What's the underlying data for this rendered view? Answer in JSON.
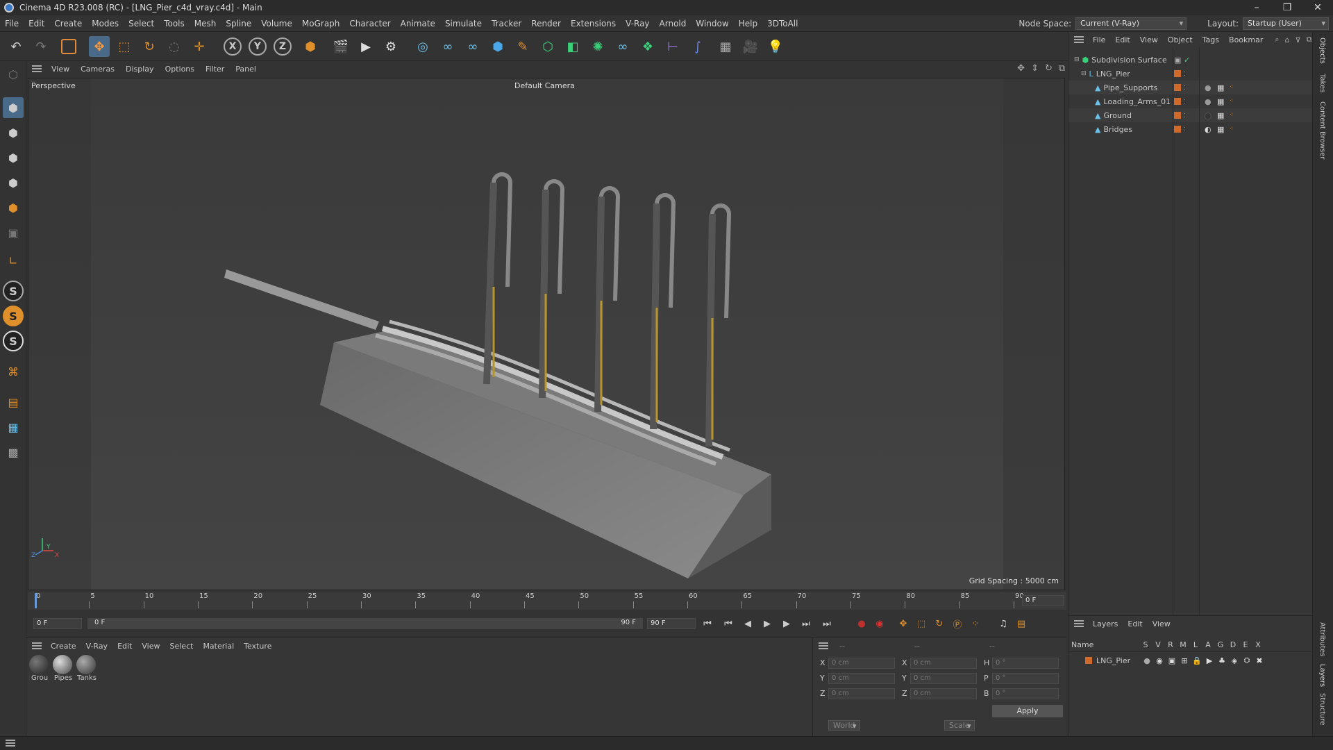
{
  "title": "Cinema 4D R23.008 (RC) - [LNG_Pier_c4d_vray.c4d] - Main",
  "window_controls": [
    "–",
    "❐",
    "✕"
  ],
  "menu": [
    "File",
    "Edit",
    "Create",
    "Modes",
    "Select",
    "Tools",
    "Mesh",
    "Spline",
    "Volume",
    "MoGraph",
    "Character",
    "Animate",
    "Simulate",
    "Tracker",
    "Render",
    "Extensions",
    "V-Ray",
    "Arnold",
    "Window",
    "Help",
    "3DToAll"
  ],
  "node_space": {
    "label": "Node Space:",
    "value": "Current (V-Ray)"
  },
  "layout": {
    "label": "Layout:",
    "value": "Startup (User)"
  },
  "viewport_menu": [
    "View",
    "Cameras",
    "Display",
    "Options",
    "Filter",
    "Panel"
  ],
  "viewport": {
    "name": "Perspective",
    "camera": "Default Camera",
    "grid_spacing": "Grid Spacing : 5000 cm",
    "axis_y": "Y",
    "axis_x": "X",
    "axis_z": "Z"
  },
  "timeline": {
    "ticks": [
      "0",
      "5",
      "10",
      "15",
      "20",
      "25",
      "30",
      "35",
      "40",
      "45",
      "50",
      "55",
      "60",
      "65",
      "70",
      "75",
      "80",
      "85",
      "90"
    ],
    "current": "0 F"
  },
  "transport": {
    "start": "0 F",
    "range_start": "0 F",
    "range_end": "90 F",
    "end": "90 F"
  },
  "material_menu": [
    "Create",
    "V-Ray",
    "Edit",
    "View",
    "Select",
    "Material",
    "Texture"
  ],
  "materials": [
    {
      "name": "Grou"
    },
    {
      "name": "Pipes"
    },
    {
      "name": "Tanks"
    }
  ],
  "coords": {
    "headers": [
      "--",
      "--",
      "--"
    ],
    "rows": [
      {
        "a": "X",
        "av": "0 cm",
        "b": "X",
        "bv": "0 cm",
        "c": "H",
        "cv": "0 °"
      },
      {
        "a": "Y",
        "av": "0 cm",
        "b": "Y",
        "bv": "0 cm",
        "c": "P",
        "cv": "0 °"
      },
      {
        "a": "Z",
        "av": "0 cm",
        "b": "Z",
        "bv": "0 cm",
        "c": "B",
        "cv": "0 °"
      }
    ],
    "mode1": "World",
    "mode2": "Scale",
    "apply": "Apply"
  },
  "object_menu": [
    "File",
    "Edit",
    "View",
    "Object",
    "Tags",
    "Bookmar"
  ],
  "objects": [
    {
      "name": "Subdivision Surface",
      "indent": 0
    },
    {
      "name": "LNG_Pier",
      "indent": 1
    },
    {
      "name": "Pipe_Supports",
      "indent": 2
    },
    {
      "name": "Loading_Arms_01",
      "indent": 2
    },
    {
      "name": "Ground",
      "indent": 2
    },
    {
      "name": "Bridges",
      "indent": 2
    }
  ],
  "layers_menu": [
    "Layers",
    "Edit",
    "View"
  ],
  "layers_header": {
    "name": "Name",
    "cols": [
      "S",
      "V",
      "R",
      "M",
      "L",
      "A",
      "G",
      "D",
      "E",
      "X"
    ]
  },
  "layers": [
    {
      "name": "LNG_Pier"
    }
  ],
  "side_tabs": [
    "Objects",
    "Takes",
    "Content Browser",
    "Attributes",
    "Layers",
    "Structure"
  ],
  "colors": {
    "accent": "#d06a2a",
    "bg": "#333333",
    "viewport": "#3d3d3d",
    "selection": "#4a5a6e"
  }
}
